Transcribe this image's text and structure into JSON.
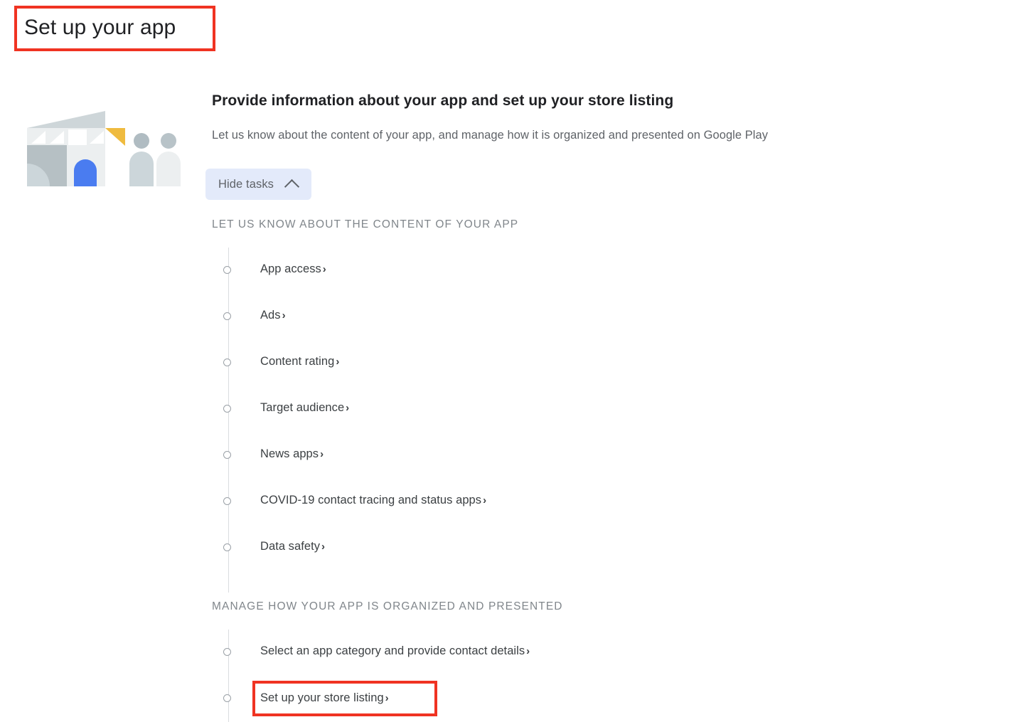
{
  "page": {
    "title": "Set up your app",
    "annotation_color": "#f03322"
  },
  "overview": {
    "heading": "Provide information about your app and set up your store listing",
    "subtitle": "Let us know about the content of your app, and manage how it is organized and presented on Google Play",
    "illustration_name": "storefront-with-people-illustration"
  },
  "toggle": {
    "label": "Hide tasks",
    "icon": "chevron-up-icon",
    "background": "#e3eafa"
  },
  "groups": [
    {
      "title": "Let us know about the content of your app",
      "tasks": [
        {
          "label": "App access",
          "arrow": "›",
          "status": "incomplete"
        },
        {
          "label": "Ads",
          "arrow": "›",
          "status": "incomplete"
        },
        {
          "label": "Content rating",
          "arrow": "›",
          "status": "incomplete"
        },
        {
          "label": "Target audience",
          "arrow": "›",
          "status": "incomplete"
        },
        {
          "label": "News apps",
          "arrow": "›",
          "status": "incomplete"
        },
        {
          "label": "COVID-19 contact tracing and status apps",
          "arrow": "›",
          "status": "incomplete"
        },
        {
          "label": "Data safety",
          "arrow": "›",
          "status": "incomplete"
        }
      ]
    },
    {
      "title": "Manage how your app is organized and presented",
      "tasks": [
        {
          "label": "Select an app category and provide contact details",
          "arrow": "›",
          "status": "incomplete"
        },
        {
          "label": "Set up your store listing",
          "arrow": "›",
          "status": "incomplete",
          "annotated": true
        }
      ]
    }
  ],
  "illustration_colors": {
    "roof": "#ced6d9",
    "awning": "#eceff0",
    "wall_left": "#b6c0c4",
    "wall_right": "#eceff0",
    "door": "#4a7cf0",
    "triangle": "#efbb3f",
    "person_left": "#ccd6da",
    "person_right": "#eceff0"
  }
}
